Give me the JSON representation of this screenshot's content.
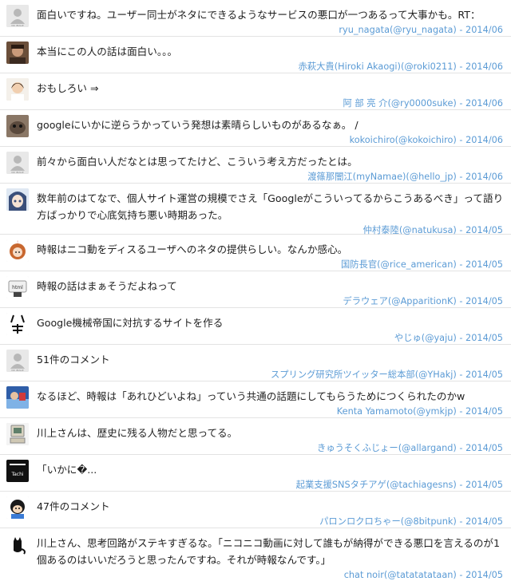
{
  "comments": [
    {
      "text": "面白いですね。ユーザー同士がネタにできるようなサービスの悪口が一つあるって大事かも。RT：",
      "meta": "ryu_nagata(@ryu_nagata) - 2014/06",
      "avatar": "no-image"
    },
    {
      "text": "本当にこの人の話は面白い。。。",
      "meta": "赤萩大貴(Hiroki Akaogi)(@roki0211) - 2014/06",
      "avatar": "photo-man"
    },
    {
      "text": "おもしろい ⇒",
      "meta": "阿 部 亮 介(@ry0000suke) - 2014/06",
      "avatar": "photo-woman"
    },
    {
      "text": "googleにいかに逆らうかっていう発想は素晴らしいものがあるなぁ。 /",
      "meta": "kokoichiro(@kokoichiro) - 2014/06",
      "avatar": "photo-animal"
    },
    {
      "text": "前々から面白い人だなとは思ってたけど、こういう考え方だったとは。",
      "meta": "渡篠那闇江(myNamae)(@hello_jp) - 2014/06",
      "avatar": "no-image"
    },
    {
      "text": "数年前のはてなで、個人サイト運営の規模でさえ「Googleがこういってるからこうあるべき」って語り方ばっかりで心底気持ち悪い時期あった。",
      "meta": "仲村泰陸(@natukusa) - 2014/05",
      "avatar": "anime-blue"
    },
    {
      "text": "時報はニコ動をディスるユーザへのネタの提供らしい。なんか感心。",
      "meta": "国防長官(@rice_american) - 2014/05",
      "avatar": "anime-orange"
    },
    {
      "text": "時報の話はまぁそうだよねって",
      "meta": "デラウェア(@ApparitionK) - 2014/05",
      "avatar": "html-sign"
    },
    {
      "text": "Google機械帝国に対抗するサイトを作る",
      "meta": "やじゅ(@yaju) - 2014/05",
      "avatar": "kanji"
    },
    {
      "text": "51件のコメント",
      "meta": "スプリング研究所ツイッター総本部(@YHakj) - 2014/05",
      "avatar": "no-image"
    },
    {
      "text": "なるほど、時報は「あれひどいよね」っていう共通の話題にしてもらうためにつくられたのかw",
      "meta": "Kenta Yamamoto(@ymkjp) - 2014/05",
      "avatar": "photo-blue"
    },
    {
      "text": "川上さんは、歴史に残る人物だと思ってる。",
      "meta": "きゅうそくふじょー(@allargand) - 2014/05",
      "avatar": "computer"
    },
    {
      "text": "「いかに�...",
      "meta": "起業支援SNSタチアゲ(@tachiagesns) - 2014/05",
      "avatar": "tachiage"
    },
    {
      "text": "47件のコメント",
      "meta": "パロンロクロちゃー(@8bitpunk) - 2014/05",
      "avatar": "character"
    },
    {
      "text": "川上さん、思考回路がステキすぎるな。「ニコニコ動画に対して誰もが納得ができる悪口を言えるのが1個あるのはいいだろうと思ったんですね。それが時報なんです。」",
      "meta": "chat noir(@tatatatataan) - 2014/05",
      "avatar": "cat"
    }
  ]
}
